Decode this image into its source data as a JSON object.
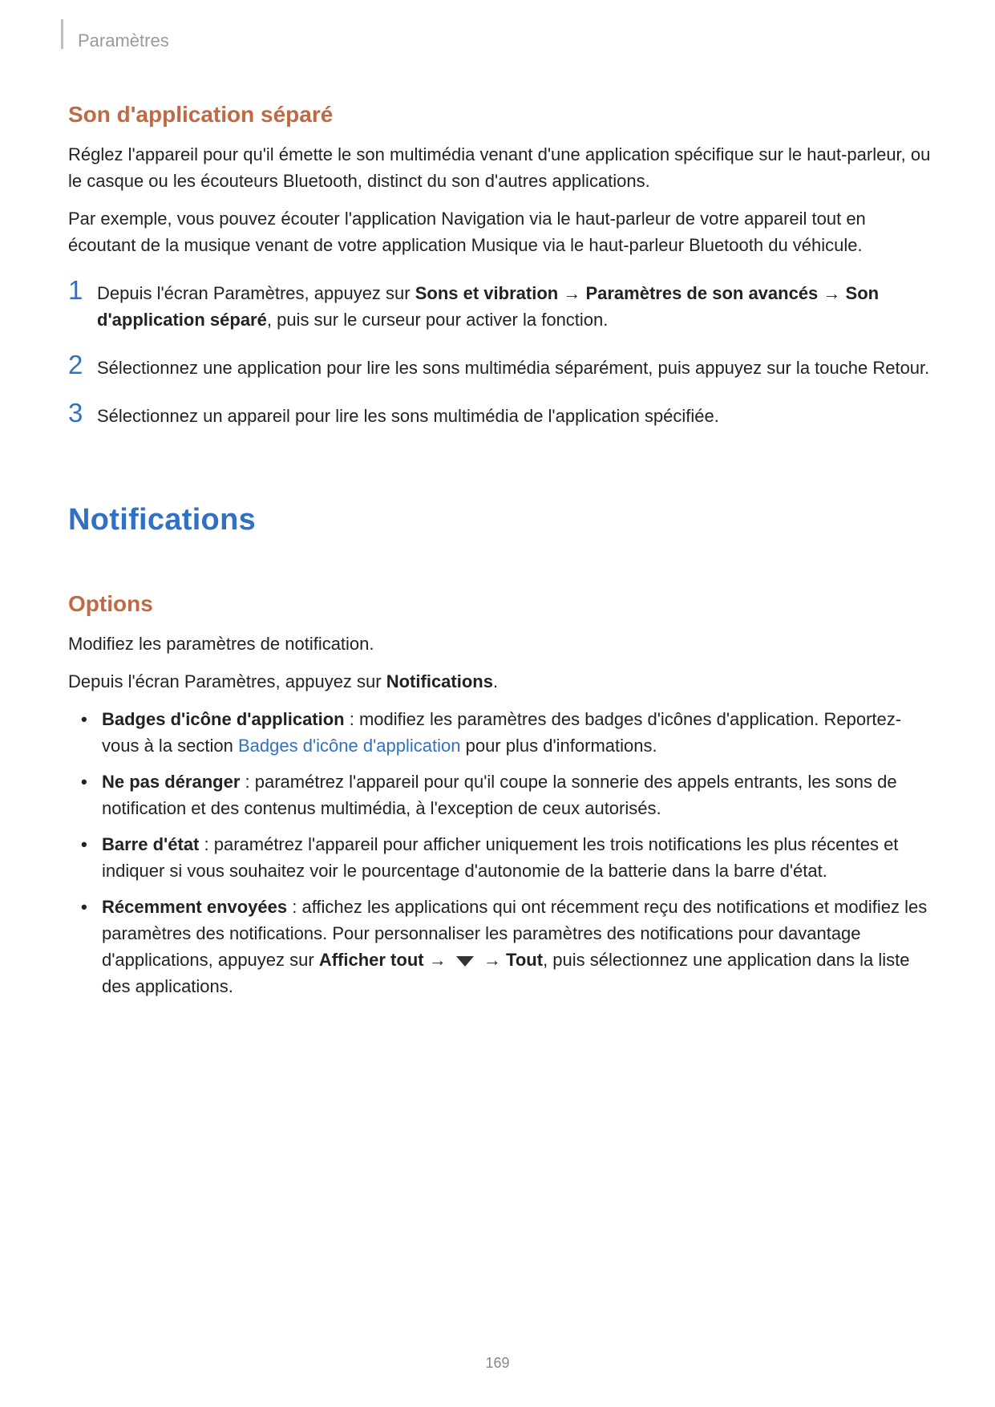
{
  "breadcrumb": "Paramètres",
  "section1": {
    "title": "Son d'application séparé",
    "p1": "Réglez l'appareil pour qu'il émette le son multimédia venant d'une application spécifique sur le haut-parleur, ou le casque ou les écouteurs Bluetooth, distinct du son d'autres applications.",
    "p2": "Par exemple, vous pouvez écouter l'application Navigation via le haut-parleur de votre appareil tout en écoutant de la musique venant de votre application Musique via le haut-parleur Bluetooth du véhicule.",
    "steps": [
      {
        "num": "1",
        "pre": "Depuis l'écran Paramètres, appuyez sur ",
        "b1": "Sons et vibration",
        "arr1": " → ",
        "b2": "Paramètres de son avancés",
        "arr2": " → ",
        "b3": "Son d'application séparé",
        "post": ", puis sur le curseur pour activer la fonction."
      },
      {
        "num": "2",
        "text": "Sélectionnez une application pour lire les sons multimédia séparément, puis appuyez sur la touche Retour."
      },
      {
        "num": "3",
        "text": "Sélectionnez un appareil pour lire les sons multimédia de l'application spécifiée."
      }
    ]
  },
  "section2": {
    "title": "Notifications",
    "sub": "Options",
    "p1": "Modifiez les paramètres de notification.",
    "p2_pre": "Depuis l'écran Paramètres, appuyez sur ",
    "p2_b": "Notifications",
    "p2_post": ".",
    "bullets": [
      {
        "b": "Badges d'icône d'application",
        "t1": " : modifiez les paramètres des badges d'icônes d'application. Reportez-vous à la section ",
        "link": "Badges d'icône d'application",
        "t2": " pour plus d'informations."
      },
      {
        "b": "Ne pas déranger",
        "t1": " : paramétrez l'appareil pour qu'il coupe la sonnerie des appels entrants, les sons de notification et des contenus multimédia, à l'exception de ceux autorisés."
      },
      {
        "b": "Barre d'état",
        "t1": " : paramétrez l'appareil pour afficher uniquement les trois notifications les plus récentes et indiquer si vous souhaitez voir le pourcentage d'autonomie de la batterie dans la barre d'état."
      },
      {
        "b": "Récemment envoyées",
        "t1": " : affichez les applications qui ont récemment reçu des notifications et modifiez les paramètres des notifications. Pour personnaliser les paramètres des notifications pour davantage d'applications, appuyez sur ",
        "b2": "Afficher tout",
        "arr1": " → ",
        "arr2": " → ",
        "b3": "Tout",
        "t2": ", puis sélectionnez une application dans la liste des applications."
      }
    ]
  },
  "pageNumber": "169"
}
